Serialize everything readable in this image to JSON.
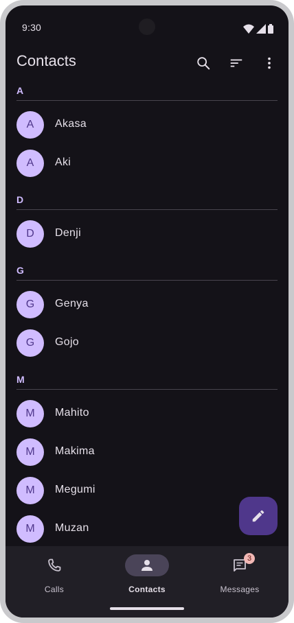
{
  "status_bar": {
    "time": "9:30",
    "icons": [
      "wifi-icon",
      "cellular-signal-icon",
      "battery-icon"
    ]
  },
  "app_bar": {
    "title": "Contacts",
    "actions": [
      "search-icon",
      "sort-icon",
      "more-vert-icon"
    ]
  },
  "contacts": {
    "sections": [
      {
        "letter": "A",
        "contacts": [
          {
            "initial": "A",
            "name": "Akasa"
          },
          {
            "initial": "A",
            "name": "Aki"
          }
        ]
      },
      {
        "letter": "D",
        "contacts": [
          {
            "initial": "D",
            "name": "Denji"
          }
        ]
      },
      {
        "letter": "G",
        "contacts": [
          {
            "initial": "G",
            "name": "Genya"
          },
          {
            "initial": "G",
            "name": "Gojo"
          }
        ]
      },
      {
        "letter": "M",
        "contacts": [
          {
            "initial": "M",
            "name": "Mahito"
          },
          {
            "initial": "M",
            "name": "Makima"
          },
          {
            "initial": "M",
            "name": "Megumi"
          },
          {
            "initial": "M",
            "name": "Muzan"
          }
        ]
      }
    ]
  },
  "fab": {
    "icon": "edit-icon"
  },
  "nav": {
    "items": [
      {
        "label": "Calls",
        "icon": "phone-icon"
      },
      {
        "label": "Contacts",
        "icon": "person-icon",
        "selected": true
      },
      {
        "label": "Messages",
        "icon": "message-icon",
        "badge": "3"
      }
    ]
  },
  "colors": {
    "background": "#141218",
    "accent": "#d0bcff",
    "fab": "#4f378b",
    "nav_background": "#211f26",
    "badge": "#f2b8b5"
  }
}
